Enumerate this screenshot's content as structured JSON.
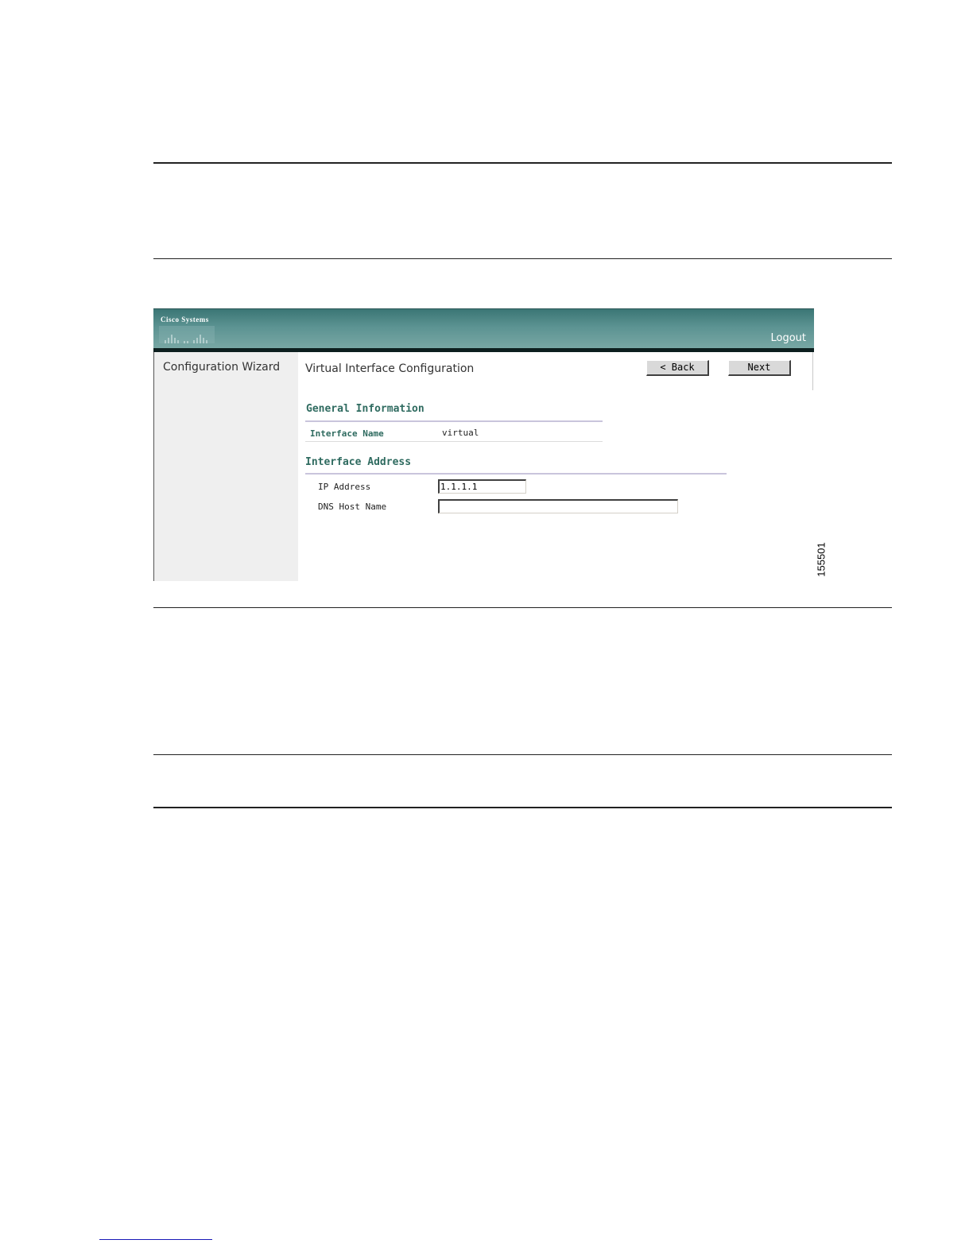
{
  "app": {
    "logo_text": "Cisco Systems",
    "logout_label": "Logout",
    "sidebar_title": "Configuration Wizard",
    "page_title": "Virtual Interface Configuration",
    "back_label": "< Back",
    "next_label": "Next"
  },
  "general_information": {
    "title": "General Information",
    "interface_name_label": "Interface Name",
    "interface_name_value": "virtual"
  },
  "interface_address": {
    "title": "Interface Address",
    "ip_label": "IP Address",
    "ip_value": "1.1.1.1",
    "dns_label": "DNS Host Name",
    "dns_value": ""
  },
  "figure_id": "155501",
  "colors": {
    "header": "#5c9392",
    "header_bar": "#0d1f1f",
    "sidebar_bg": "#efefef",
    "section_title": "#2f6b60",
    "button_bg": "#d9d9d9"
  }
}
